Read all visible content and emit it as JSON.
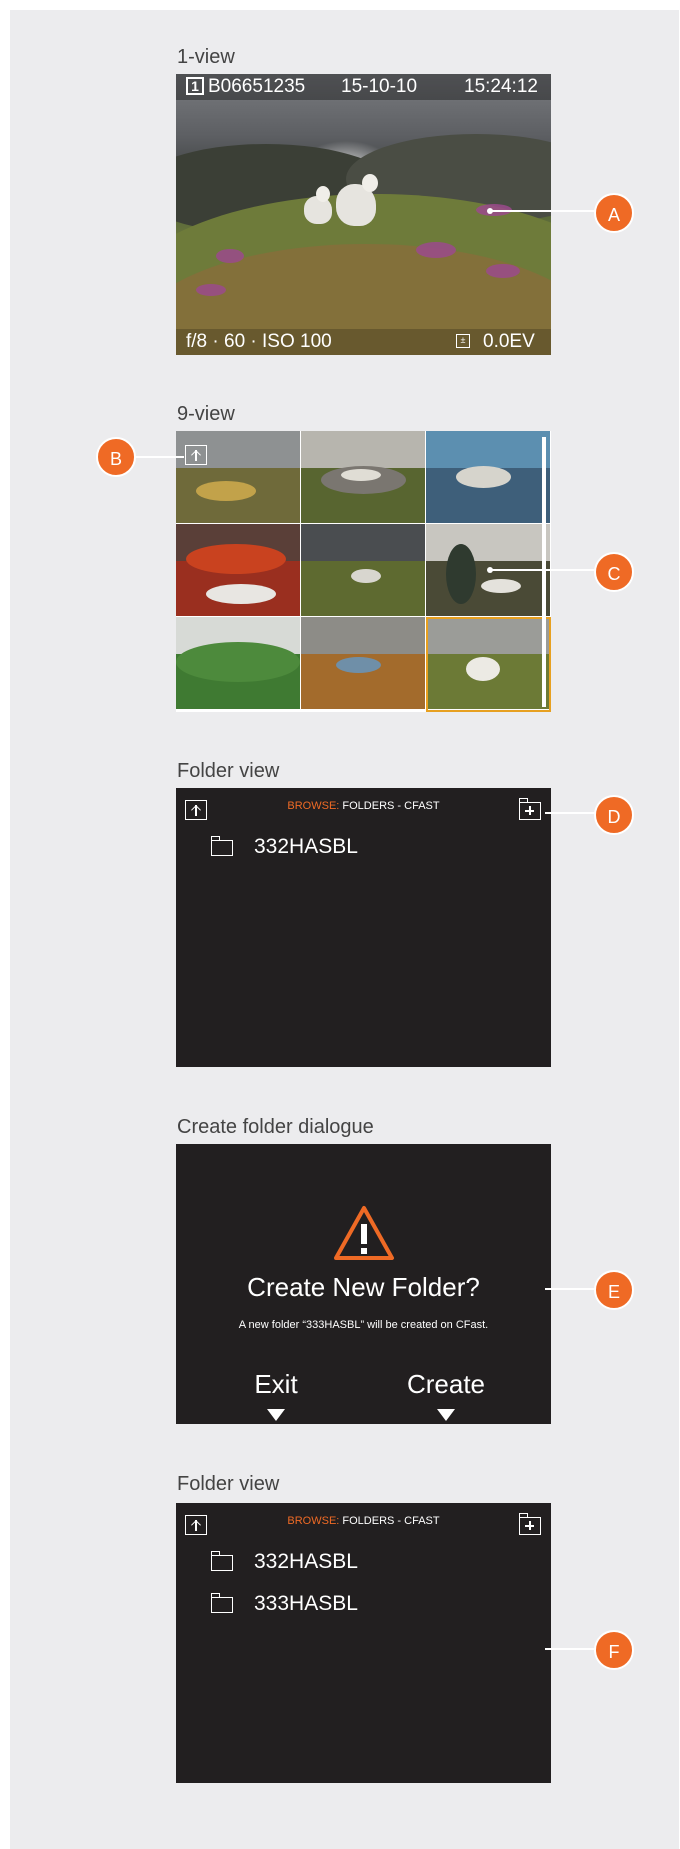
{
  "sections": {
    "one_view": {
      "title": "1-view",
      "image_number": "1",
      "image_id": "B06651235",
      "date": "15-10-10",
      "time": "15:24:12",
      "exposure": "f/8 · 60 · ISO 100",
      "ev": "0.0EV"
    },
    "nine_view": {
      "title": "9-view",
      "selected_tile": 9
    },
    "folder_view_1": {
      "title": "Folder view",
      "browse_label": "BROWSE:",
      "browse_path": "FOLDERS - CFAST",
      "folders": [
        "332HASBL"
      ]
    },
    "dialog": {
      "title": "Create folder dialogue",
      "heading": "Create New Folder?",
      "message": "A new folder “333HASBL” will be created on CFast.",
      "exit_label": "Exit",
      "create_label": "Create"
    },
    "folder_view_2": {
      "title": "Folder view",
      "browse_label": "BROWSE:",
      "browse_path": "FOLDERS - CFAST",
      "folders": [
        "332HASBL",
        "333HASBL"
      ]
    }
  },
  "markers": [
    "A",
    "B",
    "C",
    "D",
    "E",
    "F"
  ],
  "colors": {
    "accent": "#ef6a25",
    "screen": "#221f20",
    "selection": "#e7a020",
    "background": "#ececee"
  }
}
